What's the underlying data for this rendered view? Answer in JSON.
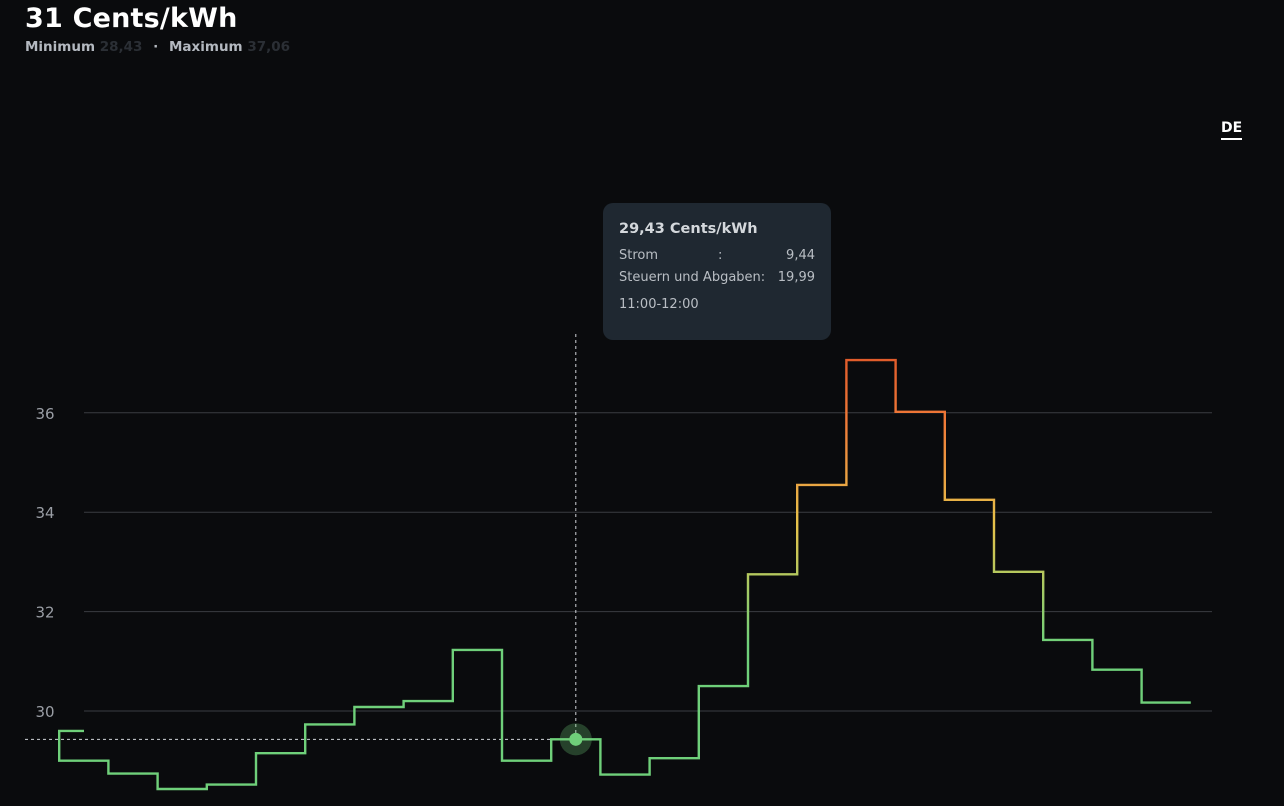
{
  "header": {
    "price_headline": "31 Cents/kWh",
    "min_label": "Minimum",
    "min_value": "28,43",
    "separator": "·",
    "max_label": "Maximum",
    "max_value": "37,06"
  },
  "region_tab": "DE",
  "tooltip": {
    "title": "29,43 Cents/kWh",
    "rows": [
      {
        "label": "Strom",
        "sep": ":",
        "value": "9,44"
      },
      {
        "label": "Steuern und Abgaben:",
        "sep": "",
        "value": "19,99"
      }
    ],
    "time": "11:00-12:00"
  },
  "colors": {
    "background": "#0a0b0d",
    "low": "#6fd07a",
    "mid": "#e6c24a",
    "high": "#f07a38",
    "peak": "#e05a2a",
    "grid": "#3a3d42",
    "axis_text": "#9a9ea5"
  },
  "chart_data": {
    "type": "line",
    "step": true,
    "title": "",
    "xlabel": "",
    "ylabel": "",
    "ylim": [
      28.2,
      38.2
    ],
    "yticks": [
      30,
      32,
      34,
      36
    ],
    "ytick_labels": [
      "30",
      "32",
      "34",
      "36"
    ],
    "grid": true,
    "highlight_index": 11,
    "series": [
      {
        "values": [
          29.6,
          29.0,
          28.74,
          28.43,
          28.52,
          29.15,
          29.73,
          30.08,
          30.2,
          31.23,
          29.0,
          29.43,
          28.72,
          29.05,
          30.5,
          32.75,
          34.55,
          37.06,
          36.02,
          34.25,
          32.8,
          31.43,
          30.83,
          30.17
        ]
      }
    ]
  }
}
